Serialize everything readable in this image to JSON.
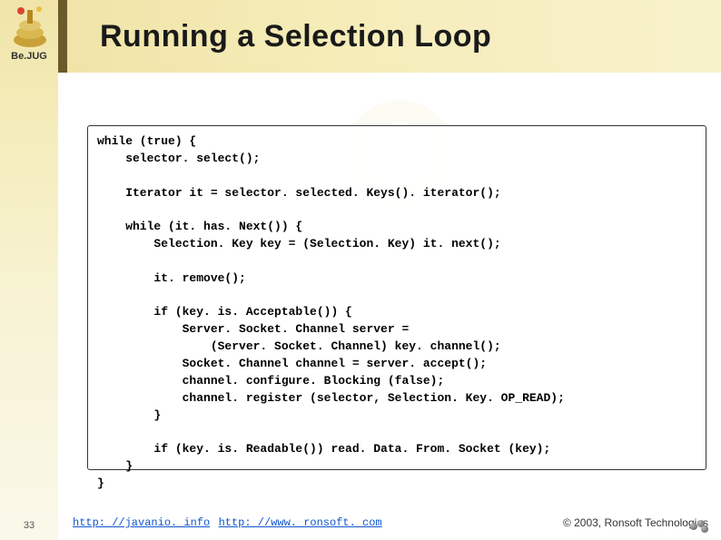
{
  "sidebar": {
    "logo_label": "Be.JUG",
    "page_number": "33"
  },
  "header": {
    "title": "Running a Selection Loop"
  },
  "code": {
    "content": "while (true) {\n    selector. select();\n\n    Iterator it = selector. selected. Keys(). iterator();\n\n    while (it. has. Next()) {\n        Selection. Key key = (Selection. Key) it. next();\n\n        it. remove();\n\n        if (key. is. Acceptable()) {\n            Server. Socket. Channel server =\n                (Server. Socket. Channel) key. channel();\n            Socket. Channel channel = server. accept();\n            channel. configure. Blocking (false);\n            channel. register (selector, Selection. Key. OP_READ);\n        }\n\n        if (key. is. Readable()) read. Data. From. Socket (key);\n    }\n}"
  },
  "footer": {
    "link1": "http: //javanio. info",
    "link2": "http: //www. ronsoft. com",
    "copyright": "© 2003, Ronsoft Technologies"
  }
}
